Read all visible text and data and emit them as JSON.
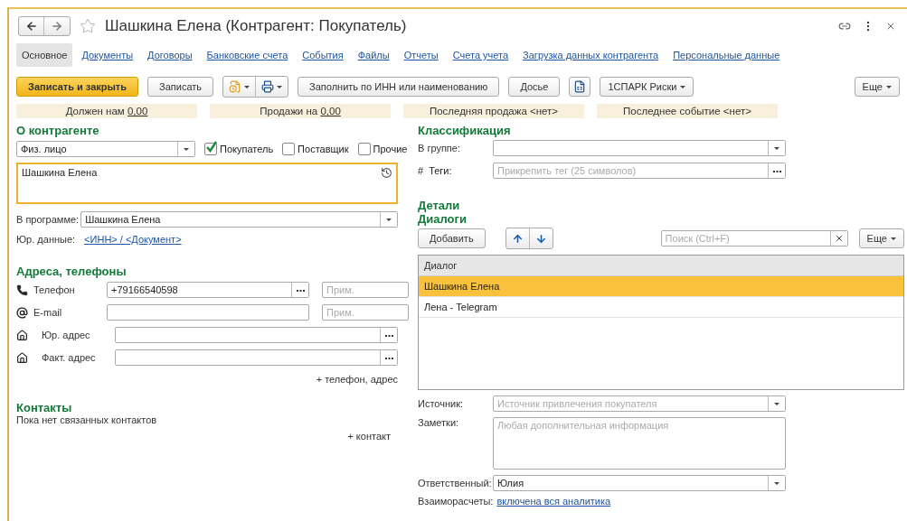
{
  "window": {
    "title": "Шашкина Елена (Контрагент: Покупатель)",
    "favorite": false
  },
  "tabs": [
    {
      "label": "Основное",
      "selected": true
    },
    {
      "label": "Документы",
      "selected": false
    },
    {
      "label": "Договоры",
      "selected": false
    },
    {
      "label": "Банковские счета",
      "selected": false
    },
    {
      "label": "События",
      "selected": false
    },
    {
      "label": "Файлы",
      "selected": false
    },
    {
      "label": "Отчеты",
      "selected": false
    },
    {
      "label": "Счета учета",
      "selected": false
    },
    {
      "label": "Загрузка данных контрагента",
      "selected": false
    },
    {
      "label": "Персональные данные",
      "selected": false
    }
  ],
  "toolbar": [
    {
      "kind": "primary",
      "label": "Записать и закрыть"
    },
    {
      "kind": "button",
      "label": "Записать"
    },
    {
      "kind": "icon-pair"
    },
    {
      "kind": "button",
      "label": "Заполнить по ИНН или наименованию"
    },
    {
      "kind": "button",
      "label": "Досье"
    },
    {
      "kind": "icon"
    },
    {
      "kind": "menu",
      "label": "1СПАРК Риски"
    },
    {
      "kind": "spacer"
    },
    {
      "kind": "menu",
      "label": "Еще"
    }
  ],
  "summary": [
    {
      "label": "Должен нам",
      "amount": "0,00"
    },
    {
      "label": "Продажи на",
      "amount": "0,00"
    },
    {
      "label": "Последняя продажа <нет>"
    },
    {
      "label": "Последнее событие <нет>"
    }
  ],
  "about": {
    "heading": "О контрагенте",
    "type": "Физ. лицо",
    "roles": [
      {
        "label": "Покупатель",
        "checked": true
      },
      {
        "label": "Поставщик",
        "checked": false
      },
      {
        "label": "Прочие",
        "checked": false
      }
    ],
    "name": "Шашкина Елена",
    "in_program_label": "В программе:",
    "in_program_value": "Шашкина Елена",
    "legal_label": "Юр. данные:",
    "legal_link": "<ИНН> / <Документ>"
  },
  "addresses": {
    "heading": "Адреса, телефоны",
    "rows": [
      {
        "kind": "phone",
        "label": "Телефон",
        "value": "+79166540598",
        "note_placeholder": "Прим."
      },
      {
        "kind": "email",
        "label": "E-mail",
        "note_placeholder": "Прим."
      },
      {
        "kind": "address",
        "label": "Юр. адрес"
      },
      {
        "kind": "address",
        "label": "Факт. адрес"
      }
    ],
    "add_link": "+ телефон, адрес"
  },
  "contacts": {
    "heading": "Контакты",
    "empty_text": "Пока нет связанных контактов",
    "add_link": "+ контакт"
  },
  "classification": {
    "heading": "Классификация",
    "group_label": "В группе:",
    "tags_mark": "#",
    "tags_label": "Теги:",
    "tags_placeholder": "Прикрепить тег (25 символов)"
  },
  "details": {
    "heading": "Детали"
  },
  "dialogs": {
    "heading": "Диалоги",
    "add_button": "Добавить",
    "search_placeholder": "Поиск (Ctrl+F)",
    "more_button": "Еще",
    "column": "Диалог",
    "rows": [
      {
        "text": "Шашкина Елена",
        "selected": true
      },
      {
        "text": "Лена - Telegram",
        "selected": false
      }
    ]
  },
  "extra": {
    "source_label": "Источник:",
    "source_placeholder": "Источник привлечения покупателя",
    "notes_label": "Заметки:",
    "notes_placeholder": "Любая дополнительная информация",
    "responsible_label": "Ответственный:",
    "responsible_value": "Юлия",
    "settlements_label": "Взаиморасчеты:",
    "settlements_link": "включена вся аналитика"
  }
}
